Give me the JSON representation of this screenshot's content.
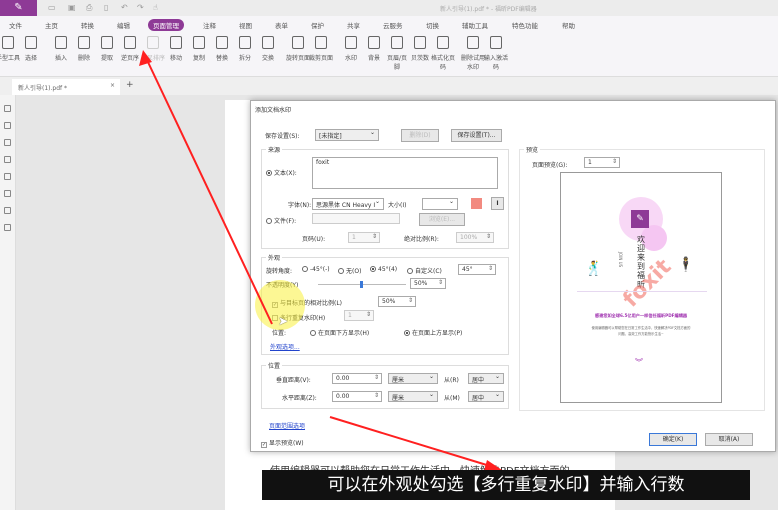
{
  "window": {
    "title": "新人引导(1).pdf * - 福昕PDF编辑器",
    "tab": "新人引导(1).pdf *"
  },
  "menu": [
    "文件",
    "主页",
    "转换",
    "编辑",
    "页面管理",
    "注释",
    "视图",
    "表单",
    "保护",
    "共享",
    "云服务",
    "切换",
    "辅助工具",
    "特色功能",
    "帮助"
  ],
  "active_menu": "页面管理",
  "ribbon": [
    {
      "label": "手型工具"
    },
    {
      "label": "选择"
    },
    {
      "label": "插入"
    },
    {
      "label": "删除"
    },
    {
      "label": "提取"
    },
    {
      "label": "逆页序"
    },
    {
      "label": "交叉排序",
      "disabled": true
    },
    {
      "label": "移动"
    },
    {
      "label": "复制"
    },
    {
      "label": "替换"
    },
    {
      "label": "拆分"
    },
    {
      "label": "交换"
    },
    {
      "label": "旋转页面"
    },
    {
      "label": "裁剪页面"
    },
    {
      "label": "水印"
    },
    {
      "label": "背景"
    },
    {
      "label": "页眉/页脚"
    },
    {
      "label": "贝茨数"
    },
    {
      "label": "格式化页码"
    },
    {
      "label": "删除试用水印"
    },
    {
      "label": "输入激活码"
    }
  ],
  "dialog": {
    "title": "添加文档水印",
    "save_settings_label": "保存设置(S):",
    "save_settings_value": "[未指定]",
    "delete_btn": "删除(D)",
    "save_btn": "保存设置(T)...",
    "source": {
      "title": "来源",
      "text_radio": "文本(X):",
      "text_value": "foxit",
      "font_label": "字体(N):",
      "font_value": "思源黑体 CN Heavy I",
      "size_label": "大小(I)",
      "size_value": "",
      "file_radio": "文件(F):",
      "browse_btn": "浏览(E)...",
      "page_label": "页码(U):",
      "page_value": "1",
      "scale_label": "绝对比例(R):",
      "scale_value": "100%",
      "color": "#f28a80"
    },
    "appearance": {
      "title": "外观",
      "rotation_label": "旋转角度:",
      "rot_options": [
        "-45°(-)",
        "无(O)",
        "45°(4)",
        "自定义(C)"
      ],
      "rot_selected": "45°(4)",
      "custom_value": "45°",
      "opacity_label": "不透明度(Y)",
      "opacity_value": "50%",
      "opacity": 50,
      "relative_label": "与目标页的相对比例(L)",
      "relative_checked": true,
      "relative_value": "50%",
      "multiline_label": "多行重复水印(H)",
      "multiline_checked": false,
      "multiline_value": "1",
      "position_label": "位置:",
      "pos_options": [
        "在页面下方显示(H)",
        "在页面上方显示(P)"
      ],
      "pos_selected": "在页面上方显示(P)",
      "more_link": "外观选项..."
    },
    "position": {
      "title": "位置",
      "vert_label": "垂直距离(V):",
      "vert_value": "0.00",
      "vert_unit": "厘米",
      "vert_from_label": "从(R)",
      "vert_from": "居中",
      "horiz_label": "水平距离(Z):",
      "horiz_value": "0.00",
      "horiz_unit": "厘米",
      "horiz_from_label": "从(M)",
      "horiz_from": "居中"
    },
    "page_range_link": "页面范围选项",
    "show_preview": "显示预览(W)",
    "preview": {
      "title": "预览",
      "page_label": "页面预览(G):",
      "page_value": "1",
      "heading": "欢迎来到福昕",
      "join": "JOIN US",
      "watermark": "foxit",
      "slogan": "感谢您如全球6.5亿用户一样信任福昕PDF编辑器",
      "desc1": "使用编辑器可以帮助您在日常工作生活中，快速解决PDF文档方面的",
      "desc2": "问题，高效工作方能快乐生活~"
    },
    "ok_btn": "确定(K)",
    "cancel_btn": "取消(A)"
  },
  "behind_text": "使用编辑器可以帮助您在日常工作生活中，快速解决PDF文档方面的",
  "caption": "可以在外观处勾选【多行重复水印】并输入行数"
}
